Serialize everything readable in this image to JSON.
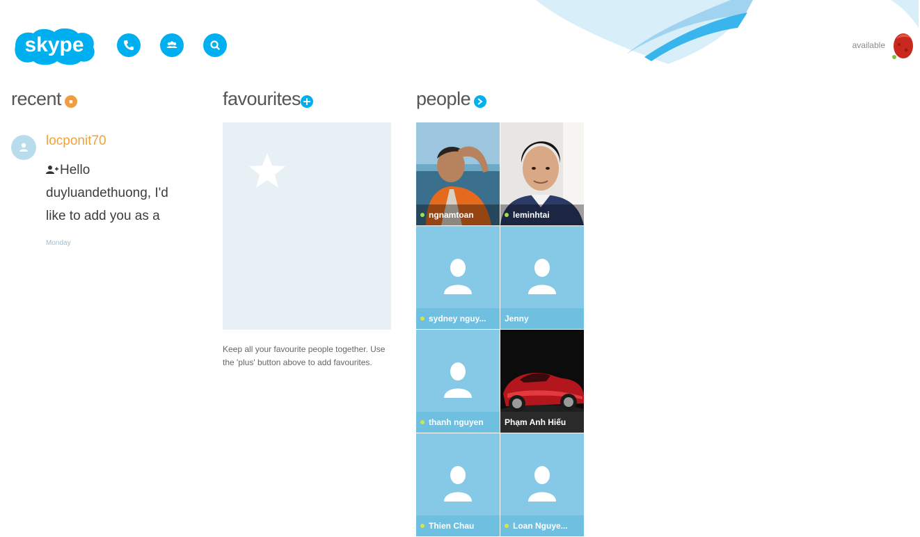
{
  "header": {
    "logo_text": "skype",
    "nav_buttons": [
      "call-icon",
      "contacts-icon",
      "search-icon"
    ],
    "status": "available",
    "accent_color": "#00aff0"
  },
  "recent": {
    "title": "recent",
    "badge_color": "#f39c3c",
    "items": [
      {
        "name": "locponit70",
        "message_icon": "add-contact-icon",
        "message": "Hello duyluandethuong, I'd like to add you as a",
        "time": "Monday"
      }
    ]
  },
  "favourites": {
    "title": "favourites",
    "hint": "Keep all your favourite people together. Use the 'plus' button above to add favourites."
  },
  "people": {
    "title": "people",
    "contacts": [
      {
        "name": "ngnamtoan",
        "online": true
      },
      {
        "name": "leminhtai",
        "online": true
      },
      {
        "name": "sydney nguy...",
        "online": true
      },
      {
        "name": "Jenny",
        "online": false
      },
      {
        "name": "thanh nguyen",
        "online": true
      },
      {
        "name": "Phạm Anh Hiếu",
        "online": false
      },
      {
        "name": "Thien Chau",
        "online": true
      },
      {
        "name": "Loan Nguye...",
        "online": true
      }
    ]
  }
}
